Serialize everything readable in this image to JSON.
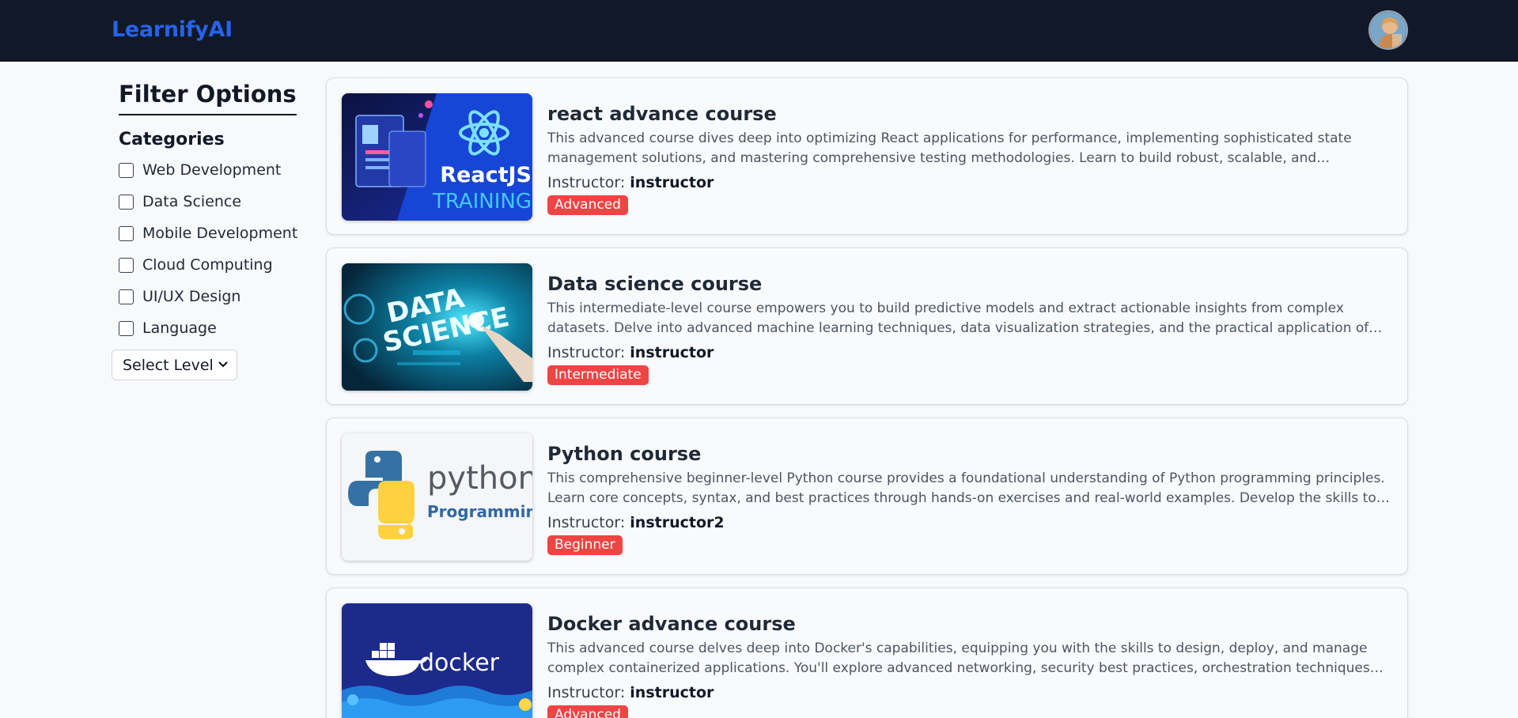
{
  "header": {
    "brand": "LearnifyAI",
    "avatar_icon": "user-avatar-icon"
  },
  "sidebar": {
    "title": "Filter Options",
    "categories_title": "Categories",
    "categories": [
      {
        "label": "Web Development",
        "checked": false
      },
      {
        "label": "Data Science",
        "checked": false
      },
      {
        "label": "Mobile Development",
        "checked": false
      },
      {
        "label": "Cloud Computing",
        "checked": false
      },
      {
        "label": "UI/UX Design",
        "checked": false
      },
      {
        "label": "Language",
        "checked": false
      }
    ],
    "level_select": {
      "selected": "Select Level"
    }
  },
  "courses": [
    {
      "title": "react advance course",
      "description": "This advanced course dives deep into optimizing React applications for performance, implementing sophisticated state management solutions, and mastering comprehensive testing methodologies. Learn to build robust, scalable, and maintainable React applications using industry best practices.",
      "instructor_label": "Instructor:",
      "instructor": "instructor",
      "level": "Advanced",
      "thumb_text_1": "ReactJS",
      "thumb_text_2": "TRAINING"
    },
    {
      "title": "Data science course",
      "description": "This intermediate-level course empowers you to build predictive models and extract actionable insights from complex datasets. Delve into advanced machine learning techniques, data visualization strategies, and the practical application of data science principles to solve real-world problems.",
      "instructor_label": "Instructor:",
      "instructor": "instructor",
      "level": "Intermediate",
      "thumb_text_1": "DATA",
      "thumb_text_2": "SCIENCE"
    },
    {
      "title": "Python course",
      "description": "This comprehensive beginner-level Python course provides a foundational understanding of Python programming principles. Learn core concepts, syntax, and best practices through hands-on exercises and real-world examples. Develop the skills to write clean, efficient, and maintainable Python code.",
      "instructor_label": "Instructor:",
      "instructor": "instructor2",
      "level": "Beginner",
      "thumb_text_1": "python",
      "thumb_text_2": "Programming"
    },
    {
      "title": "Docker advance course",
      "description": "This advanced course delves deep into Docker's capabilities, equipping you with the skills to design, deploy, and manage complex containerized applications. You'll explore advanced networking, security best practices, orchestration techniques using Docker Swarm and more.",
      "instructor_label": "Instructor:",
      "instructor": "instructor",
      "level": "Advanced",
      "thumb_text_1": "docker"
    }
  ],
  "colors": {
    "header_bg": "#111827",
    "brand": "#2563eb",
    "badge": "#ef4444"
  }
}
